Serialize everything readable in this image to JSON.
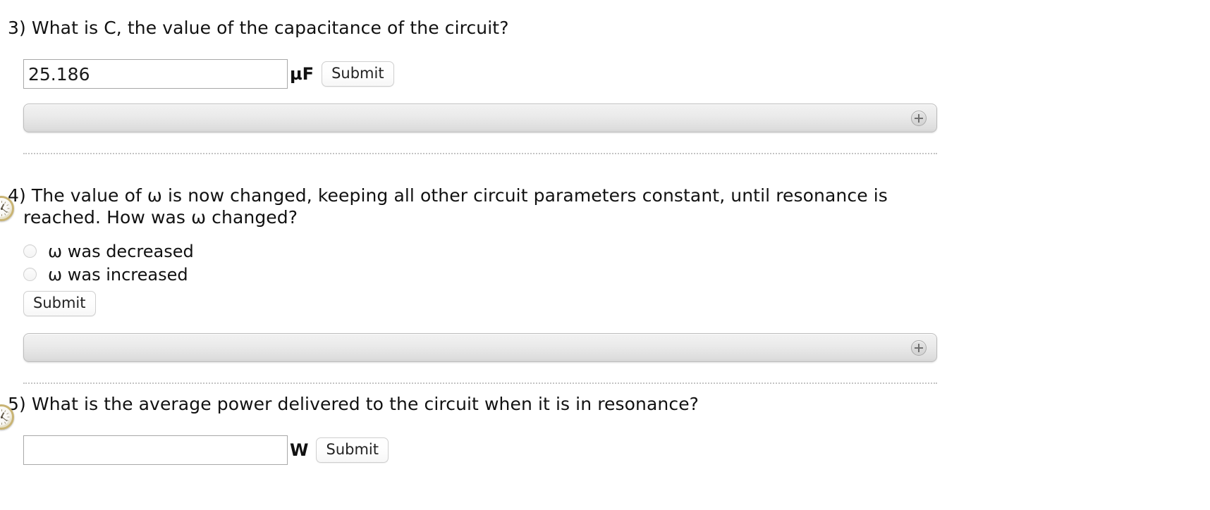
{
  "questions": [
    {
      "number": "3)",
      "text": "3) What is C, the value of the capacitance of the circuit?",
      "input_value": "25.186",
      "input_placeholder": "",
      "unit": "µF",
      "submit_label": "Submit",
      "has_clock_icon": false,
      "hint_bar_icon": "plus-icon"
    },
    {
      "number": "4)",
      "text": "4) The value of ω is now changed, keeping all other circuit parameters constant, until resonance is reached. How was ω changed?",
      "choices": [
        {
          "label": "ω was decreased",
          "selected": false
        },
        {
          "label": "ω was increased",
          "selected": false
        }
      ],
      "submit_label": "Submit",
      "has_clock_icon": true,
      "hint_bar_icon": "plus-icon"
    },
    {
      "number": "5)",
      "text": "5) What is the average power delivered to the circuit when it is in resonance?",
      "input_value": "",
      "input_placeholder": "",
      "unit": "W",
      "submit_label": "Submit",
      "has_clock_icon": true
    }
  ],
  "colors": {
    "text": "#111111",
    "input_border": "#a8a8a8",
    "hint_bar_border": "#bdbdbd",
    "separator": "#c4c4c4",
    "clock_rim": "#c9b474"
  }
}
